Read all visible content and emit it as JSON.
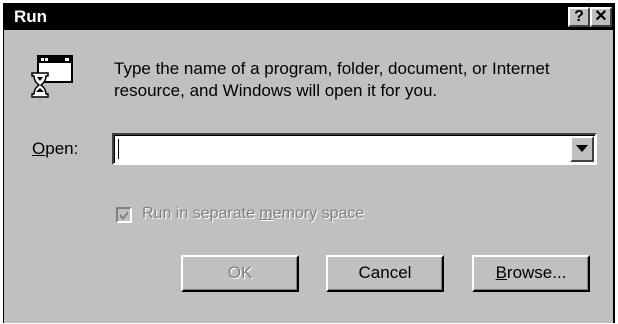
{
  "window": {
    "title": "Run",
    "help_label": "?",
    "close_label": "✕",
    "icons": {
      "app": "run-icon",
      "help": "help-icon",
      "close": "close-icon"
    }
  },
  "description": "Type the name of a program, folder, document, or Internet resource, and Windows will open it for you.",
  "open": {
    "label_mnemonic": "O",
    "label_rest": "pen:",
    "value": "",
    "dropdown_icon": "chevron-down-icon"
  },
  "memory_option": {
    "label_pre": "Run in separate ",
    "label_mnemonic": "m",
    "label_post": "emory space",
    "checked": true,
    "enabled": false
  },
  "buttons": {
    "ok": "OK",
    "cancel": "Cancel",
    "browse_mnemonic": "B",
    "browse_rest": "rowse..."
  },
  "colors": {
    "face": "#c0c0c0",
    "titlebar": "#000000",
    "disabled_text": "#808080"
  }
}
